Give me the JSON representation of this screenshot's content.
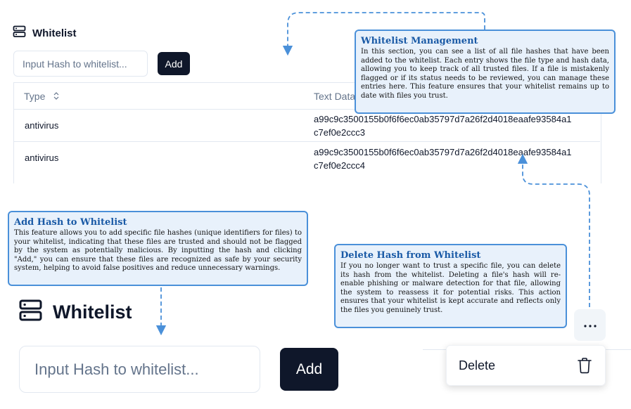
{
  "whitelist_panel": {
    "title": "Whitelist",
    "input_placeholder": "Input Hash to whitelist...",
    "add_label": "Add",
    "columns": {
      "type": "Type",
      "text_data": "Text Data"
    },
    "rows": [
      {
        "type": "antivirus",
        "hash_line1": "a99c9c3500155b0f6f6ec0ab35797d7a26f2d4018eaafe93584a1",
        "hash_line2": "c7ef0e2ccc3"
      },
      {
        "type": "antivirus",
        "hash_line1": "a99c9c3500155b0f6f6ec0ab35797d7a26f2d4018eaafe93584a1",
        "hash_line2": "c7ef0e2ccc4"
      }
    ]
  },
  "zoom": {
    "title": "Whitelist",
    "input_placeholder": "Input Hash to whitelist...",
    "add_label": "Add",
    "menu_delete_label": "Delete"
  },
  "callouts": {
    "management": {
      "title": "Whitelist Management",
      "body": "In this section, you can see a list of all file hashes that have been added to the whitelist. Each entry shows the file type and hash data, allowing you to keep track of all trusted files. If a file is mistakenly flagged or if its status needs to be reviewed, you can manage these entries here. This feature ensures that your whitelist remains up to date with files you trust."
    },
    "add_hash": {
      "title": "Add Hash to Whitelist",
      "body": "This feature allows you to add specific file hashes (unique identifiers for files) to your whitelist, indicating that these files are trusted and should not be flagged by the system as potentially malicious. By inputting the hash and clicking \"Add,\" you can ensure that these files are recognized as safe by your security system, helping to avoid false positives and reduce unnecessary warnings."
    },
    "delete_hash": {
      "title": "Delete Hash from Whitelist",
      "body": "If you no longer want to trust a specific file, you can delete its hash from the whitelist. Deleting a file's hash will re-enable phishing or malware detection for that file, allowing the system to reassess it for potential risks. This action ensures that your whitelist is kept accurate and reflects only the files you genuinely trust."
    }
  },
  "icons": {
    "server": "server-icon",
    "sort": "sort-icon",
    "more": "more-icon",
    "trash": "trash-icon"
  },
  "colors": {
    "callout_border": "#4a90d9",
    "callout_bg": "#e8f1fb",
    "callout_title": "#1a5aa6",
    "button_dark": "#0f172a"
  }
}
